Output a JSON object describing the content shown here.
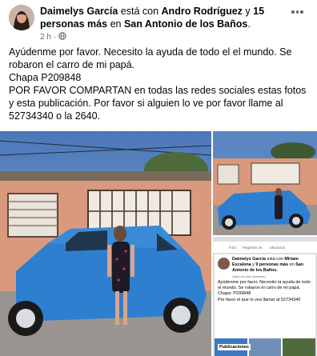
{
  "post": {
    "author": "Daimelys García",
    "connector_with": "está con",
    "tagged": "Andro Rodríguez",
    "connector_and": "y",
    "others": "15 personas más",
    "connector_in": "en",
    "location": "San Antonio de los Baños",
    "location_suffix": ".",
    "time": "2 h",
    "separator": "·",
    "text_lines": [
      "Ayúdenme por favor. Necesito la ayuda de todo el el mundo. Se robaron el carro de mi papá.",
      "Chapa P209848",
      "POR FAVOR COMPARTAN en todas las redes sociales estas fotos y esta publicación. Por favor si alguien lo ve por favor llame al 52734340 o la 2640."
    ]
  },
  "screenshot": {
    "tab_photo": "Foto",
    "tab_register": "Registrar ve.",
    "tab_location": "Ubicación",
    "author": "Daimelys García",
    "connector_with": "está con",
    "tagged": "Miriam Escalona",
    "connector_and": "y",
    "others": "9 personas más",
    "connector_in": "en",
    "location": "San Antonio de los Baños.",
    "time": "Justo en este momento",
    "body_lines": [
      "Ayúdenme por favor. Necesito la ayuda de todo el mundo. Se robaron el carro de mi papá.",
      "Chapa: P209848",
      "Por favor el que lo vea llamar al 52734340"
    ],
    "publications": "Publicaciones"
  },
  "colors": {
    "car_blue": "#2f7fd0",
    "text": "#050505",
    "meta": "#65676b"
  },
  "icons": {
    "globe": "globe-icon",
    "more": "more-horizontal-icon"
  }
}
